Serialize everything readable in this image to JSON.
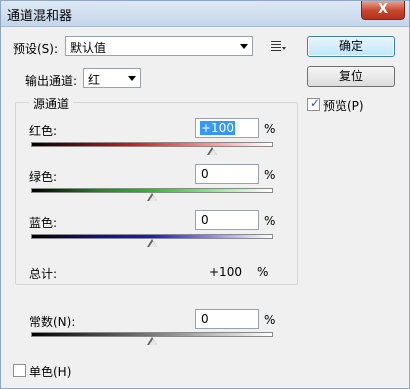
{
  "window": {
    "title": "通道混和器",
    "close_label": "X"
  },
  "preset": {
    "label": "预设(S):",
    "value": "默认值"
  },
  "output": {
    "label": "输出通道:",
    "value": "红"
  },
  "buttons": {
    "ok": "确定",
    "reset": "复位"
  },
  "preview": {
    "label": "预览(P)",
    "checked": true
  },
  "source": {
    "title": "源通道",
    "red": {
      "label": "红色:",
      "value": "+100",
      "unit": "%",
      "level": 100
    },
    "green": {
      "label": "绿色:",
      "value": "0",
      "unit": "%",
      "level": 0
    },
    "blue": {
      "label": "蓝色:",
      "value": "0",
      "unit": "%",
      "level": 0
    },
    "total": {
      "label": "总计:",
      "value": "+100",
      "unit": "%"
    }
  },
  "constant": {
    "label": "常数(N):",
    "value": "0",
    "unit": "%",
    "level": 0
  },
  "mono": {
    "label": "单色(H)",
    "checked": false
  },
  "colors": {
    "red": "#d11a1a",
    "green": "#26c026",
    "blue": "#1a1acc"
  }
}
